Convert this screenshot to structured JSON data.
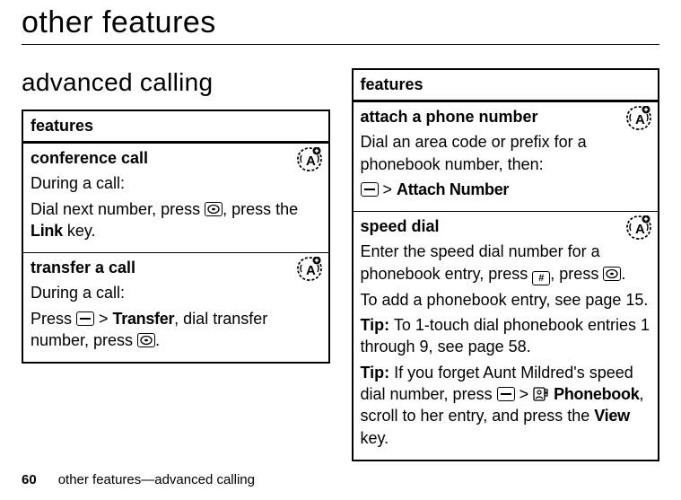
{
  "page": {
    "title": "other features",
    "sectionHeading": "advanced calling",
    "footerPage": "60",
    "footerText": "other features—advanced calling"
  },
  "leftTable": {
    "header": "features",
    "rows": [
      {
        "title": "conference call",
        "line1": "During a call:",
        "line2a": "Dial next number, press ",
        "line2b": ", press the ",
        "linkKey": "Link",
        "line2c": " key."
      },
      {
        "title": "transfer a call",
        "line1": "During a call:",
        "line2a": "Press ",
        "gt": " > ",
        "transfer": "Transfer",
        "line2b": ", dial transfer number, press ",
        "line2c": "."
      }
    ]
  },
  "rightTable": {
    "header": "features",
    "rows": [
      {
        "title": "attach a phone number",
        "line1": "Dial an area code or prefix for a phonebook number, then:",
        "gt": " > ",
        "attach": "Attach Number"
      },
      {
        "title": "speed dial",
        "line1a": "Enter the speed dial number for a phonebook entry, press ",
        "line1b": ", press ",
        "line1c": ".",
        "line2": "To add a phonebook entry, see page 15.",
        "tip1a": "Tip:",
        "tip1b": " To 1-touch dial phonebook entries 1 through 9, see page 58.",
        "tip2a": "Tip:",
        "tip2b": " If you forget Aunt Mildred's speed dial number, press ",
        "gt": " > ",
        "phonebook": "Phonebook",
        "tip2c": ", scroll to her entry, and press the ",
        "viewKey": "View",
        "tip2d": " key."
      }
    ]
  }
}
